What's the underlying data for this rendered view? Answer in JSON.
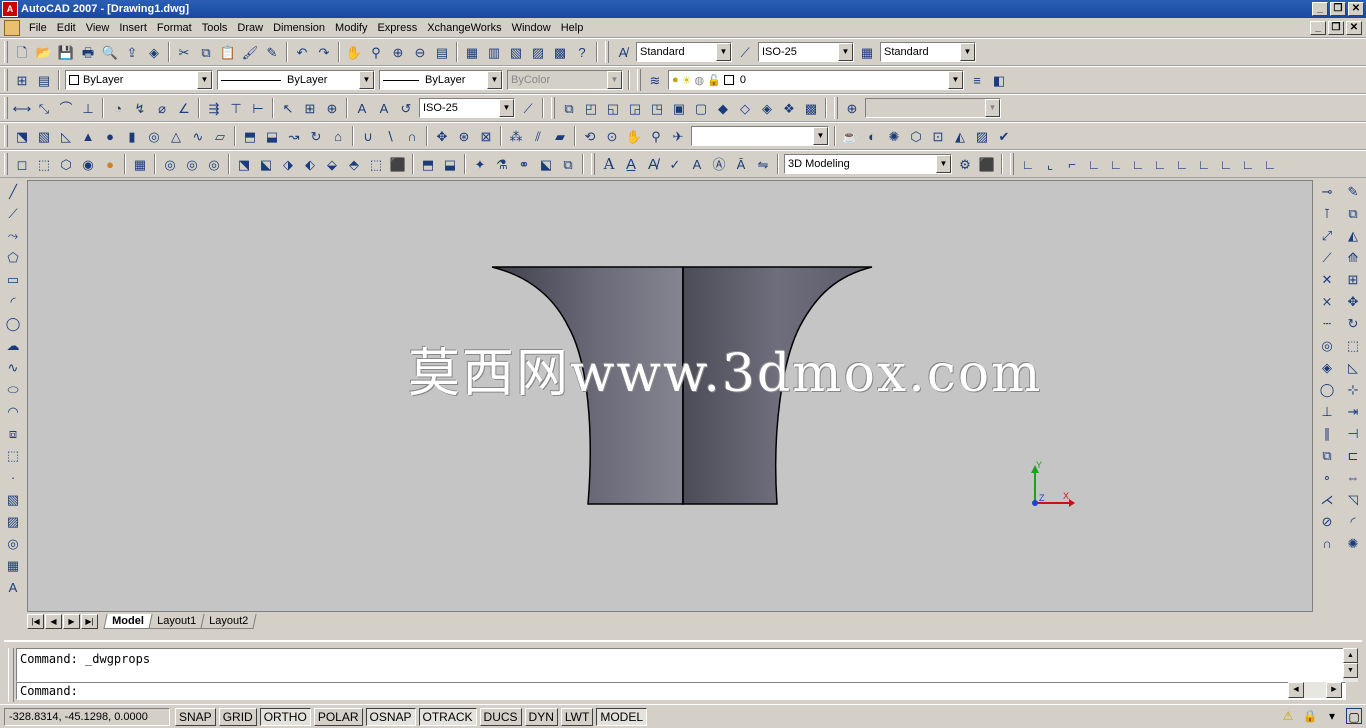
{
  "window": {
    "title": "AutoCAD 2007 - [Drawing1.dwg]",
    "minimize": "_",
    "restore": "❐",
    "close": "✕"
  },
  "menu": [
    "File",
    "Edit",
    "View",
    "Insert",
    "Format",
    "Tools",
    "Draw",
    "Dimension",
    "Modify",
    "Express",
    "XchangeWorks",
    "Window",
    "Help"
  ],
  "styles": {
    "text_style": "Standard",
    "dim_style": "ISO-25",
    "table_style": "Standard"
  },
  "properties": {
    "color": "ByLayer",
    "linetype": "ByLayer",
    "lineweight": "ByLayer",
    "plotstyle": "ByColor",
    "layer": "0"
  },
  "dimension_toolbar": {
    "dim_style": "ISO-25"
  },
  "workspace": {
    "name": "3D Modeling"
  },
  "drawing": {
    "watermark": "莫西网www.3dmox.com",
    "ucs_x": "X",
    "ucs_y": "Y",
    "ucs_z": "Z",
    "colors": {
      "background": "#c5c5c5",
      "solid_dark": "#4a4a58",
      "solid_light": "#7a7a88",
      "ucs_x": "#d01010",
      "ucs_y": "#20a020",
      "ucs_z": "#2040d0"
    }
  },
  "layout_tabs": [
    "Model",
    "Layout1",
    "Layout2"
  ],
  "command": {
    "history": "Command:  _dwgprops",
    "prompt": "Command:"
  },
  "status": {
    "coordinates": "-328.8314, -45.1298, 0.0000",
    "toggles": [
      "SNAP",
      "GRID",
      "ORTHO",
      "POLAR",
      "OSNAP",
      "OTRACK",
      "DUCS",
      "DYN",
      "LWT",
      "MODEL"
    ],
    "active_toggles": [
      "ORTHO",
      "OSNAP",
      "OTRACK",
      "MODEL"
    ]
  },
  "icons": {
    "row1": [
      "new-icon",
      "open-icon",
      "save-icon",
      "plot-icon",
      "plot-preview-icon",
      "publish-icon",
      "3d-dwf-icon",
      "cut-icon",
      "copy-icon",
      "paste-icon",
      "match-properties-icon",
      "block-editor-icon",
      "undo-icon",
      "redo-icon",
      "pan-icon",
      "zoom-realtime-icon",
      "zoom-window-icon",
      "zoom-previous-icon",
      "properties-icon",
      "design-center-icon",
      "tool-palettes-icon",
      "sheet-set-icon",
      "markup-icon",
      "quickcalc-icon",
      "help-icon"
    ],
    "row2": [
      "layer-manager-icon",
      "layer-previous-icon"
    ],
    "row3": [
      "linear-dim-icon",
      "aligned-dim-icon",
      "arc-length-icon",
      "ordinate-icon",
      "radius-icon",
      "jogged-icon",
      "diameter-icon",
      "angular-icon",
      "quick-dim-icon",
      "baseline-icon",
      "continue-icon",
      "quick-leader-icon",
      "tolerance-icon",
      "center-mark-icon",
      "dimedit-icon",
      "dimtedit-icon",
      "dim-update-icon"
    ],
    "left": [
      "line-icon",
      "construction-line-icon",
      "polyline-icon",
      "polygon-icon",
      "rectangle-icon",
      "arc-icon",
      "circle-icon",
      "revision-cloud-icon",
      "spline-icon",
      "ellipse-icon",
      "ellipse-arc-icon",
      "insert-block-icon",
      "make-block-icon",
      "point-icon",
      "hatch-icon",
      "gradient-icon",
      "region-icon",
      "table-icon",
      "mtext-icon"
    ],
    "right_a": [
      "snap-temp-icon",
      "snap-from-icon",
      "snap-endpoint-icon",
      "snap-midpoint-icon",
      "snap-intersection-icon",
      "snap-apparent-icon",
      "snap-extension-icon",
      "snap-center-icon",
      "snap-quadrant-icon",
      "snap-tangent-icon",
      "snap-perpendicular-icon",
      "snap-parallel-icon",
      "snap-insert-icon",
      "snap-node-icon",
      "snap-nearest-icon",
      "snap-none-icon",
      "osnap-settings-icon"
    ],
    "right_b": [
      "erase-icon",
      "copy-object-icon",
      "mirror-icon",
      "offset-icon",
      "array-icon",
      "move-icon",
      "rotate-icon",
      "scale-icon",
      "stretch-icon",
      "trim-icon",
      "extend-icon",
      "break-at-point-icon",
      "break-icon",
      "join-icon",
      "chamfer-icon",
      "fillet-icon",
      "explode-icon"
    ]
  }
}
